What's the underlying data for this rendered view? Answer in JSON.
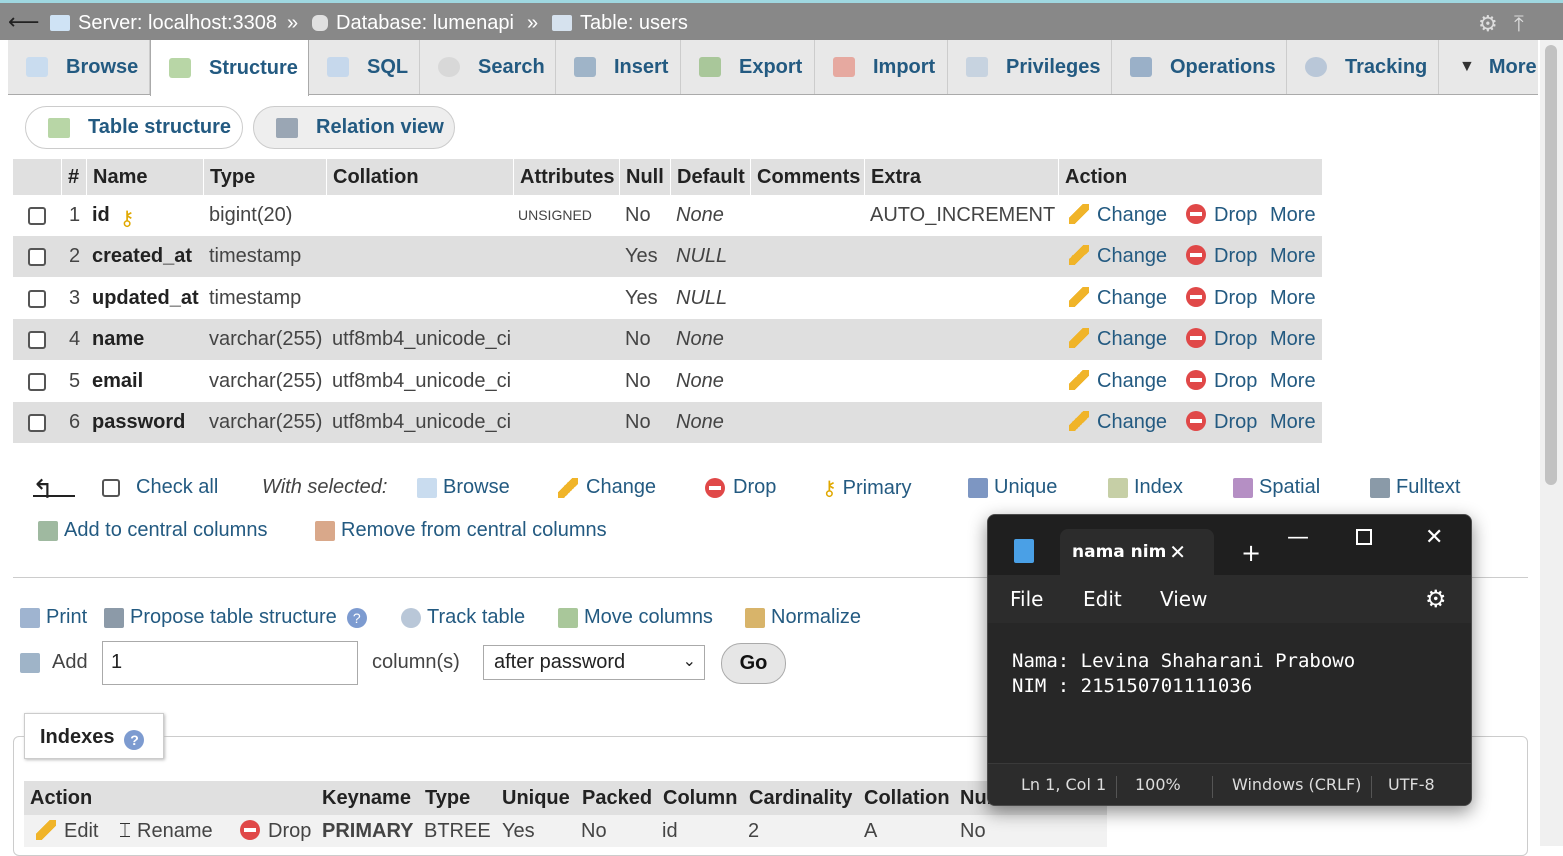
{
  "breadcrumb": {
    "server": "Server: localhost:3308",
    "database": "Database: lumenapi",
    "table": "Table: users",
    "sep": "»"
  },
  "tabs": [
    {
      "label": "Browse"
    },
    {
      "label": "Structure"
    },
    {
      "label": "SQL"
    },
    {
      "label": "Search"
    },
    {
      "label": "Insert"
    },
    {
      "label": "Export"
    },
    {
      "label": "Import"
    },
    {
      "label": "Privileges"
    },
    {
      "label": "Operations"
    },
    {
      "label": "Tracking"
    },
    {
      "label": "More"
    }
  ],
  "subtabs": {
    "table_structure": "Table structure",
    "relation_view": "Relation view"
  },
  "columns_header": {
    "num": "#",
    "name": "Name",
    "type": "Type",
    "collation": "Collation",
    "attributes": "Attributes",
    "null": "Null",
    "default": "Default",
    "comments": "Comments",
    "extra": "Extra",
    "action": "Action"
  },
  "columns": [
    {
      "num": "1",
      "name": "id",
      "type": "bigint(20)",
      "collation": "",
      "attributes": "UNSIGNED",
      "null": "No",
      "default": "None",
      "extra": "AUTO_INCREMENT"
    },
    {
      "num": "2",
      "name": "created_at",
      "type": "timestamp",
      "collation": "",
      "attributes": "",
      "null": "Yes",
      "default": "NULL",
      "extra": ""
    },
    {
      "num": "3",
      "name": "updated_at",
      "type": "timestamp",
      "collation": "",
      "attributes": "",
      "null": "Yes",
      "default": "NULL",
      "extra": ""
    },
    {
      "num": "4",
      "name": "name",
      "type": "varchar(255)",
      "collation": "utf8mb4_unicode_ci",
      "attributes": "",
      "null": "No",
      "default": "None",
      "extra": ""
    },
    {
      "num": "5",
      "name": "email",
      "type": "varchar(255)",
      "collation": "utf8mb4_unicode_ci",
      "attributes": "",
      "null": "No",
      "default": "None",
      "extra": ""
    },
    {
      "num": "6",
      "name": "password",
      "type": "varchar(255)",
      "collation": "utf8mb4_unicode_ci",
      "attributes": "",
      "null": "No",
      "default": "None",
      "extra": ""
    }
  ],
  "row_actions": {
    "change": "Change",
    "drop": "Drop",
    "more": "More"
  },
  "bulk": {
    "check_all": "Check all",
    "with_selected": "With selected:",
    "browse": "Browse",
    "change": "Change",
    "drop": "Drop",
    "primary": "Primary",
    "unique": "Unique",
    "index": "Index",
    "spatial": "Spatial",
    "fulltext": "Fulltext",
    "add_central": "Add to central columns",
    "remove_central": "Remove from central columns"
  },
  "tools": {
    "print": "Print",
    "propose": "Propose table structure",
    "track": "Track table",
    "move": "Move columns",
    "normalize": "Normalize"
  },
  "add_columns": {
    "label": "Add",
    "count": "1",
    "columns_label": "column(s)",
    "position": "after password",
    "go": "Go"
  },
  "indexes": {
    "legend": "Indexes",
    "header": {
      "action": "Action",
      "keyname": "Keyname",
      "type": "Type",
      "unique": "Unique",
      "packed": "Packed",
      "column": "Column",
      "cardinality": "Cardinality",
      "collation": "Collation",
      "null": "Null"
    },
    "row": {
      "edit": "Edit",
      "rename": "Rename",
      "drop": "Drop",
      "keyname": "PRIMARY",
      "type": "BTREE",
      "unique": "Yes",
      "packed": "No",
      "column": "id",
      "cardinality": "2",
      "collation": "A",
      "null": "No"
    }
  },
  "notepad": {
    "tab_title": "nama nim",
    "menu": {
      "file": "File",
      "edit": "Edit",
      "view": "View"
    },
    "lines": [
      "Nama: Levina Shaharani Prabowo",
      "NIM : 215150701111036"
    ],
    "status": {
      "position": "Ln 1, Col 1",
      "zoom": "100%",
      "line_ending": "Windows (CRLF)",
      "encoding": "UTF-8"
    }
  },
  "colors": {
    "link": "#235a81",
    "header_bg": "#e0e0e0",
    "top_bar": "#888888",
    "notepad_bg": "#272727"
  }
}
